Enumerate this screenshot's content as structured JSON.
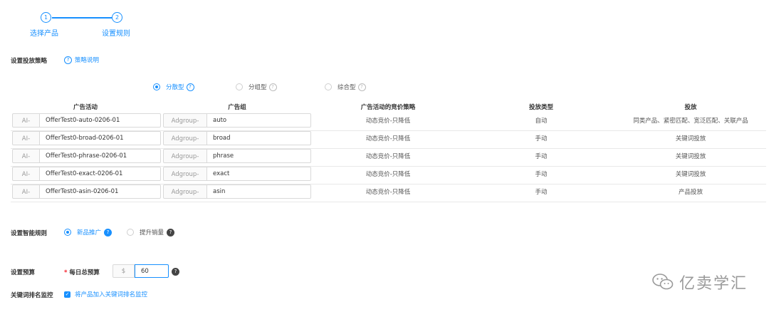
{
  "steps": [
    {
      "number": "1",
      "label": "选择产品"
    },
    {
      "number": "2",
      "label": "设置规则"
    }
  ],
  "strategy": {
    "label": "设置投放策略",
    "help_icon": "question-circle-icon",
    "help_link": "策略说明",
    "options": [
      {
        "label": "分散型",
        "checked": true
      },
      {
        "label": "分组型",
        "checked": false
      },
      {
        "label": "综合型",
        "checked": false
      }
    ]
  },
  "table": {
    "headers": [
      "广告活动",
      "广告组",
      "广告活动的竞价策略",
      "投放类型",
      "投放"
    ],
    "campaign_prefix": "AI-",
    "adgroup_prefix": "Adgroup-",
    "rows": [
      {
        "campaign": "OfferTest0-auto-0206-01",
        "adgroup": "auto",
        "bidding": "动态竞价-只降低",
        "type": "自动",
        "targeting": "同类产品、紧密匹配、宽泛匹配、关联产品"
      },
      {
        "campaign": "OfferTest0-broad-0206-01",
        "adgroup": "broad",
        "bidding": "动态竞价-只降低",
        "type": "手动",
        "targeting": "关键词投放"
      },
      {
        "campaign": "OfferTest0-phrase-0206-01",
        "adgroup": "phrase",
        "bidding": "动态竞价-只降低",
        "type": "手动",
        "targeting": "关键词投放"
      },
      {
        "campaign": "OfferTest0-exact-0206-01",
        "adgroup": "exact",
        "bidding": "动态竞价-只降低",
        "type": "手动",
        "targeting": "关键词投放"
      },
      {
        "campaign": "OfferTest0-asin-0206-01",
        "adgroup": "asin",
        "bidding": "动态竞价-只降低",
        "type": "手动",
        "targeting": "产品投放"
      }
    ]
  },
  "smart_rules": {
    "label": "设置智能规则",
    "options": [
      {
        "label": "新品推广",
        "checked": true
      },
      {
        "label": "提升销量",
        "checked": false
      }
    ]
  },
  "budget": {
    "label": "设置预算",
    "required_mark": "*",
    "field_label": "每日总预算",
    "currency": "$",
    "value": "60"
  },
  "keyword_monitor": {
    "label": "关键词排名监控",
    "checkbox_label": "将产品加入关键词排名监控",
    "checked": true
  },
  "watermark": {
    "text": "亿卖学汇",
    "icon": "wechat-icon"
  },
  "colors": {
    "accent": "#1890ff",
    "required": "#f5222d"
  }
}
